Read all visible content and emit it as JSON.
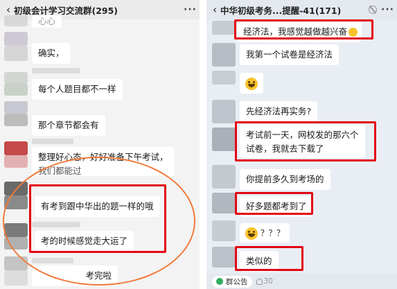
{
  "left": {
    "title": "初级会计学习交流群(295)",
    "back": "‹",
    "more": "···",
    "top_fragment": "心心",
    "messages": [
      "确实，",
      "每个人题目都不一样",
      "那个章节都会有",
      "整理好心态，好好准备下午考试，",
      "我们都能过",
      "有考到跟中华出的题一样的哦",
      "考的时候感觉走大运了",
      "考完啦"
    ]
  },
  "right": {
    "title": "中华初级考务...提醒-41(171)",
    "back": "‹",
    "more": "···",
    "messages": [
      "经济法，我感觉越做越兴奋",
      "我第一个试卷是经济法",
      "先经济法再实务?",
      "考试前一天，网校发的那六个",
      "试卷，我就去下载了",
      "你提前多久到考场的",
      "好多题都考到了",
      "？？？",
      "类似的"
    ],
    "footer": {
      "announcement": "群公告",
      "member_count": "30"
    }
  },
  "colors": {
    "highlight": "#e30613",
    "circle": "#f07a3a",
    "announcement_icon": "#2fae5f"
  }
}
